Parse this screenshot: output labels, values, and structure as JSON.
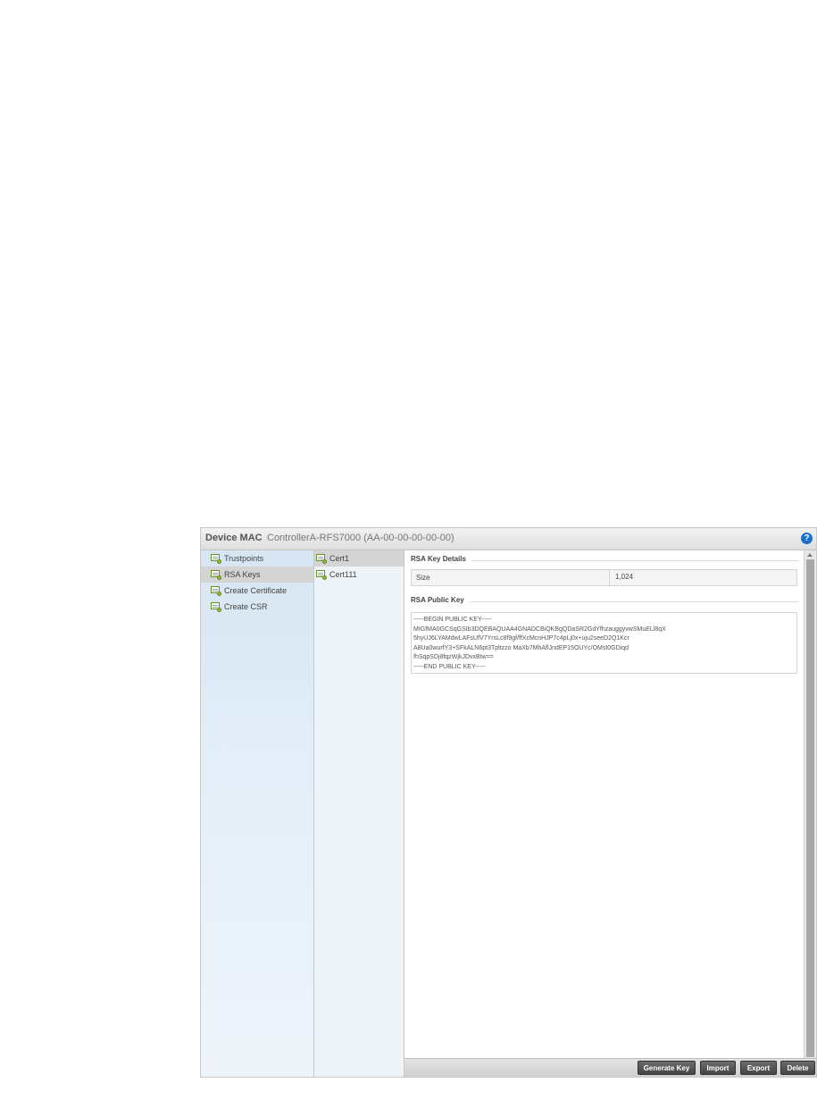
{
  "header": {
    "label": "Device MAC",
    "value": "ControllerA-RFS7000 (AA-00-00-00-00-00)",
    "help_icon": "help-icon"
  },
  "nav": {
    "items": [
      {
        "label": "Trustpoints",
        "selected": false
      },
      {
        "label": "RSA Keys",
        "selected": true
      },
      {
        "label": "Create Certificate",
        "selected": false
      },
      {
        "label": "Create CSR",
        "selected": false
      }
    ]
  },
  "keys": {
    "items": [
      {
        "label": "Cert1",
        "selected": true
      },
      {
        "label": "Cert111",
        "selected": false
      }
    ]
  },
  "details": {
    "section_title": "RSA Key Details",
    "size_label": "Size",
    "size_value": "1,024",
    "public_key_title": "RSA Public Key",
    "public_key_lines": [
      "-----BEGIN PUBLIC KEY-----",
      "MIGfMA0GCSqGSIb3DQEBAQUAA4GNADCBiQKBgQDaSR2GdYfhzauggyvwSMuELl8qX",
      "5hyUJ6LYAMdwLAFsUfV7YrsLc8f9gf/ffXcMcnHJP7c4pLj0x+uju2seeD2Q1Kcr",
      "A8Ua0wurfY3+SFkALN6pt3Tpltzzo MaXb7MhAflJndEP15OUYc/OMst0GDiqd",
      "fhSqpSDj8fqzWjkJDvxBtw==",
      "-----END PUBLIC KEY-----"
    ]
  },
  "footer": {
    "generate_key": "Generate Key",
    "import": "Import",
    "export": "Export",
    "delete": "Delete"
  },
  "colors": {
    "help": "#1a6fc9",
    "selected_row": "#d4d4d4",
    "button": "#555555"
  }
}
